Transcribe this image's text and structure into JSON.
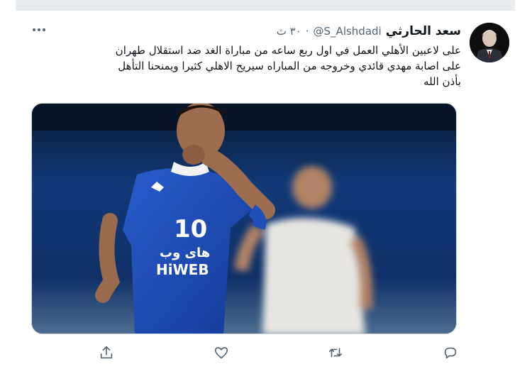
{
  "tweet": {
    "author_name": "سعد الحارثي",
    "handle": "@S_Alshdadi",
    "separator": "·",
    "time": "٣٠ ث",
    "text_lines": [
      "على لاعبين الأهلي العمل في اول ربع ساعه من مباراة الغد ضد استقلال طهران",
      "على اصابة مهدي قائدي وخروجه من المباراه سيريح الاهلي كثيرا ويمنحنا التأهل",
      "بأذن الله"
    ]
  },
  "media": {
    "jersey_number": "10",
    "sponsor_arabic": "های وب",
    "sponsor_latin": "HiWEB"
  },
  "actions": {
    "reply_icon": "reply-icon",
    "retweet_icon": "retweet-icon",
    "like_icon": "heart-icon",
    "share_icon": "share-icon"
  },
  "colors": {
    "text": "#0f1419",
    "secondary": "#536471",
    "jersey": "#1f4fb8",
    "stadium": "#0b2750"
  }
}
